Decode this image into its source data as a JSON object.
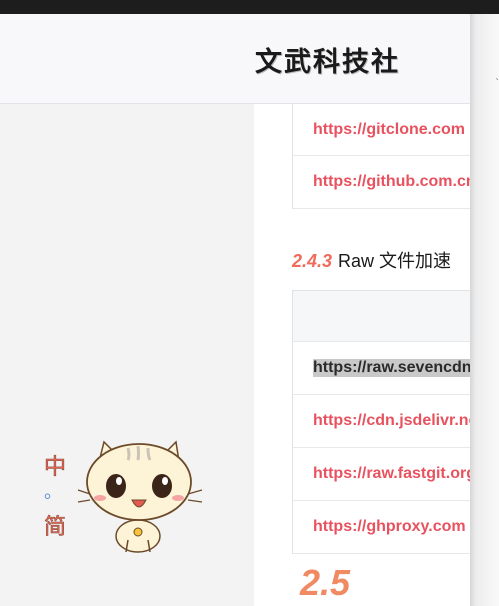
{
  "header": {
    "title": "文武科技社"
  },
  "links_table_top": {
    "rows": [
      "https://gitclone.com",
      "https://github.com.cnpmjs.org"
    ]
  },
  "raw_section": {
    "number": "2.4.3",
    "title": "Raw 文件加速",
    "rows": [
      "https://raw.sevencdn.com",
      "https://cdn.jsdelivr.net",
      "https://raw.fastgit.org",
      "https://ghproxy.com"
    ]
  },
  "next_section": {
    "number": "2.5"
  },
  "sticker": {
    "text_top": "中",
    "text_mid": "。",
    "text_bottom": "简"
  }
}
